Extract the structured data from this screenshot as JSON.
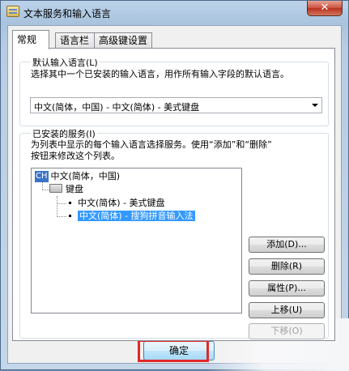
{
  "window": {
    "title": "文本服务和输入语言",
    "close_symbol": "✕"
  },
  "tabs": [
    {
      "label": "常规",
      "active": true
    },
    {
      "label": "语言栏",
      "active": false
    },
    {
      "label": "高级键设置",
      "active": false
    }
  ],
  "default_language": {
    "label": "默认输入语言(L)",
    "description": "选择其中一个已安装的输入语言，用作所有输入字段的默认语言。",
    "selected": "中文(简体，中国) - 中文(简体) - 美式键盘"
  },
  "installed_services": {
    "label": "已安装的服务(I)",
    "description_line1": "为列表中显示的每个输入语言选择服务。使用“添加”和“删除”",
    "description_line2": "按钮来修改这个列表。",
    "tree": {
      "language_badge": "CH",
      "language": "中文(简体，中国)",
      "category": "键盘",
      "items": [
        "中文(简体) - 美式键盘",
        "中文(简体) - 搜狗拼音输入法"
      ],
      "selected_index": 1
    },
    "buttons": {
      "add": "添加(D)...",
      "remove": "删除(R)",
      "properties": "属性(P)...",
      "move_up": "上移(U)",
      "move_down": "下移(O)"
    }
  },
  "footer": {
    "ok": "确定"
  },
  "colors": {
    "selection": "#3399ff",
    "highlight_box": "#e02828"
  }
}
